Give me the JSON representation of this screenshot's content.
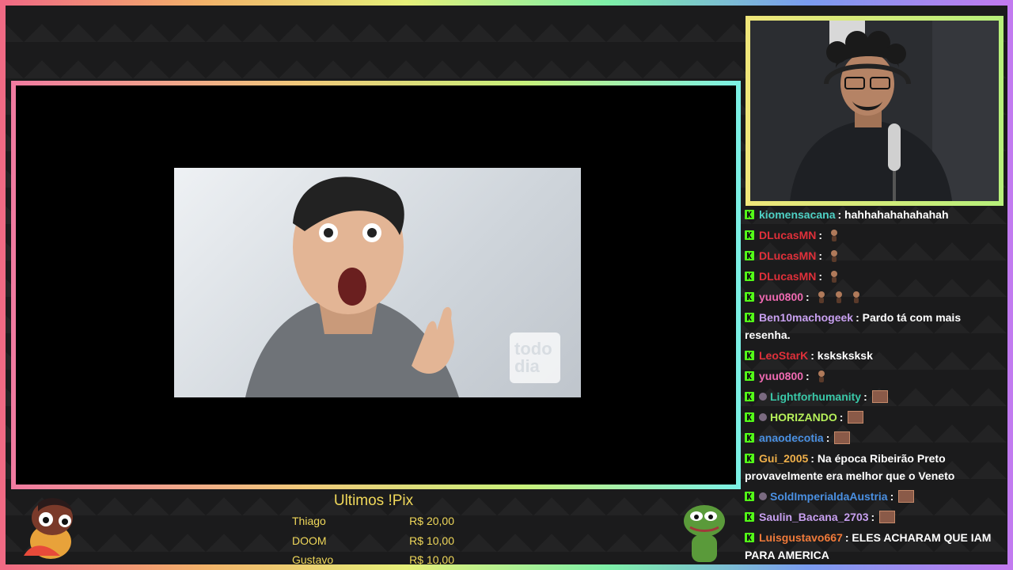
{
  "colors": {
    "frame_gradient": [
      "#f06a84",
      "#f2b36a",
      "#e6f07a",
      "#7ef0a8",
      "#7a9cf0",
      "#c27af0"
    ],
    "kick_green": "#53fc18",
    "pix_gold": "#f0d85a"
  },
  "video": {
    "clip_logo": "todo dia"
  },
  "pix": {
    "title": "Ultimos !Pix",
    "entries": [
      {
        "name": "Thiago",
        "amount": "R$ 20,00"
      },
      {
        "name": "DOOM",
        "amount": "R$ 10,00"
      },
      {
        "name": "Gustavo",
        "amount": "R$ 10,00"
      }
    ]
  },
  "chat": {
    "messages": [
      {
        "user": "kiomensacana",
        "color": "#4fd1c5",
        "text": ": hahhahahahahahah",
        "emotes": 0
      },
      {
        "user": "DLucasMN",
        "color": "#e0303a",
        "text": ":",
        "emotes": 1
      },
      {
        "user": "DLucasMN",
        "color": "#e0303a",
        "text": ":",
        "emotes": 1
      },
      {
        "user": "DLucasMN",
        "color": "#e0303a",
        "text": ":",
        "emotes": 1
      },
      {
        "user": "yuu0800",
        "color": "#f06ab2",
        "text": ":",
        "emotes": 3
      },
      {
        "user": "Ben10machogeek",
        "color": "#c8a0f0",
        "text": ": Pardo tá com mais resenha.",
        "emotes": 0
      },
      {
        "user": "LeoStarK",
        "color": "#e0303a",
        "text": ": ksksksksk",
        "emotes": 0
      },
      {
        "user": "yuu0800",
        "color": "#f06ab2",
        "text": ":",
        "emotes": 1
      },
      {
        "user": "Lightforhumanity",
        "color": "#3ac8a8",
        "text": ":",
        "emotes": 0,
        "box": true,
        "icon": true
      },
      {
        "user": "HORIZANDO",
        "color": "#b6f05a",
        "text": ":",
        "emotes": 0,
        "box": true,
        "icon": true
      },
      {
        "user": "anaodecotia",
        "color": "#4a90e2",
        "text": ":",
        "emotes": 0,
        "box": true
      },
      {
        "user": "Gui_2005",
        "color": "#f0b04a",
        "text": ": Na época Ribeirão Preto provavelmente era melhor que o Veneto",
        "emotes": 0
      },
      {
        "user": "SoldImperialdaAustria",
        "color": "#4a90e2",
        "text": ":",
        "emotes": 0,
        "box": true,
        "icon": true
      },
      {
        "user": "Saulin_Bacana_2703",
        "color": "#c8a0f0",
        "text": ":",
        "emotes": 0,
        "box": true
      },
      {
        "user": "Luisgustavo667",
        "color": "#f07a3a",
        "text": ": ELES ACHARAM QUE IAM PARA AMERICA",
        "emotes": 0
      }
    ]
  }
}
